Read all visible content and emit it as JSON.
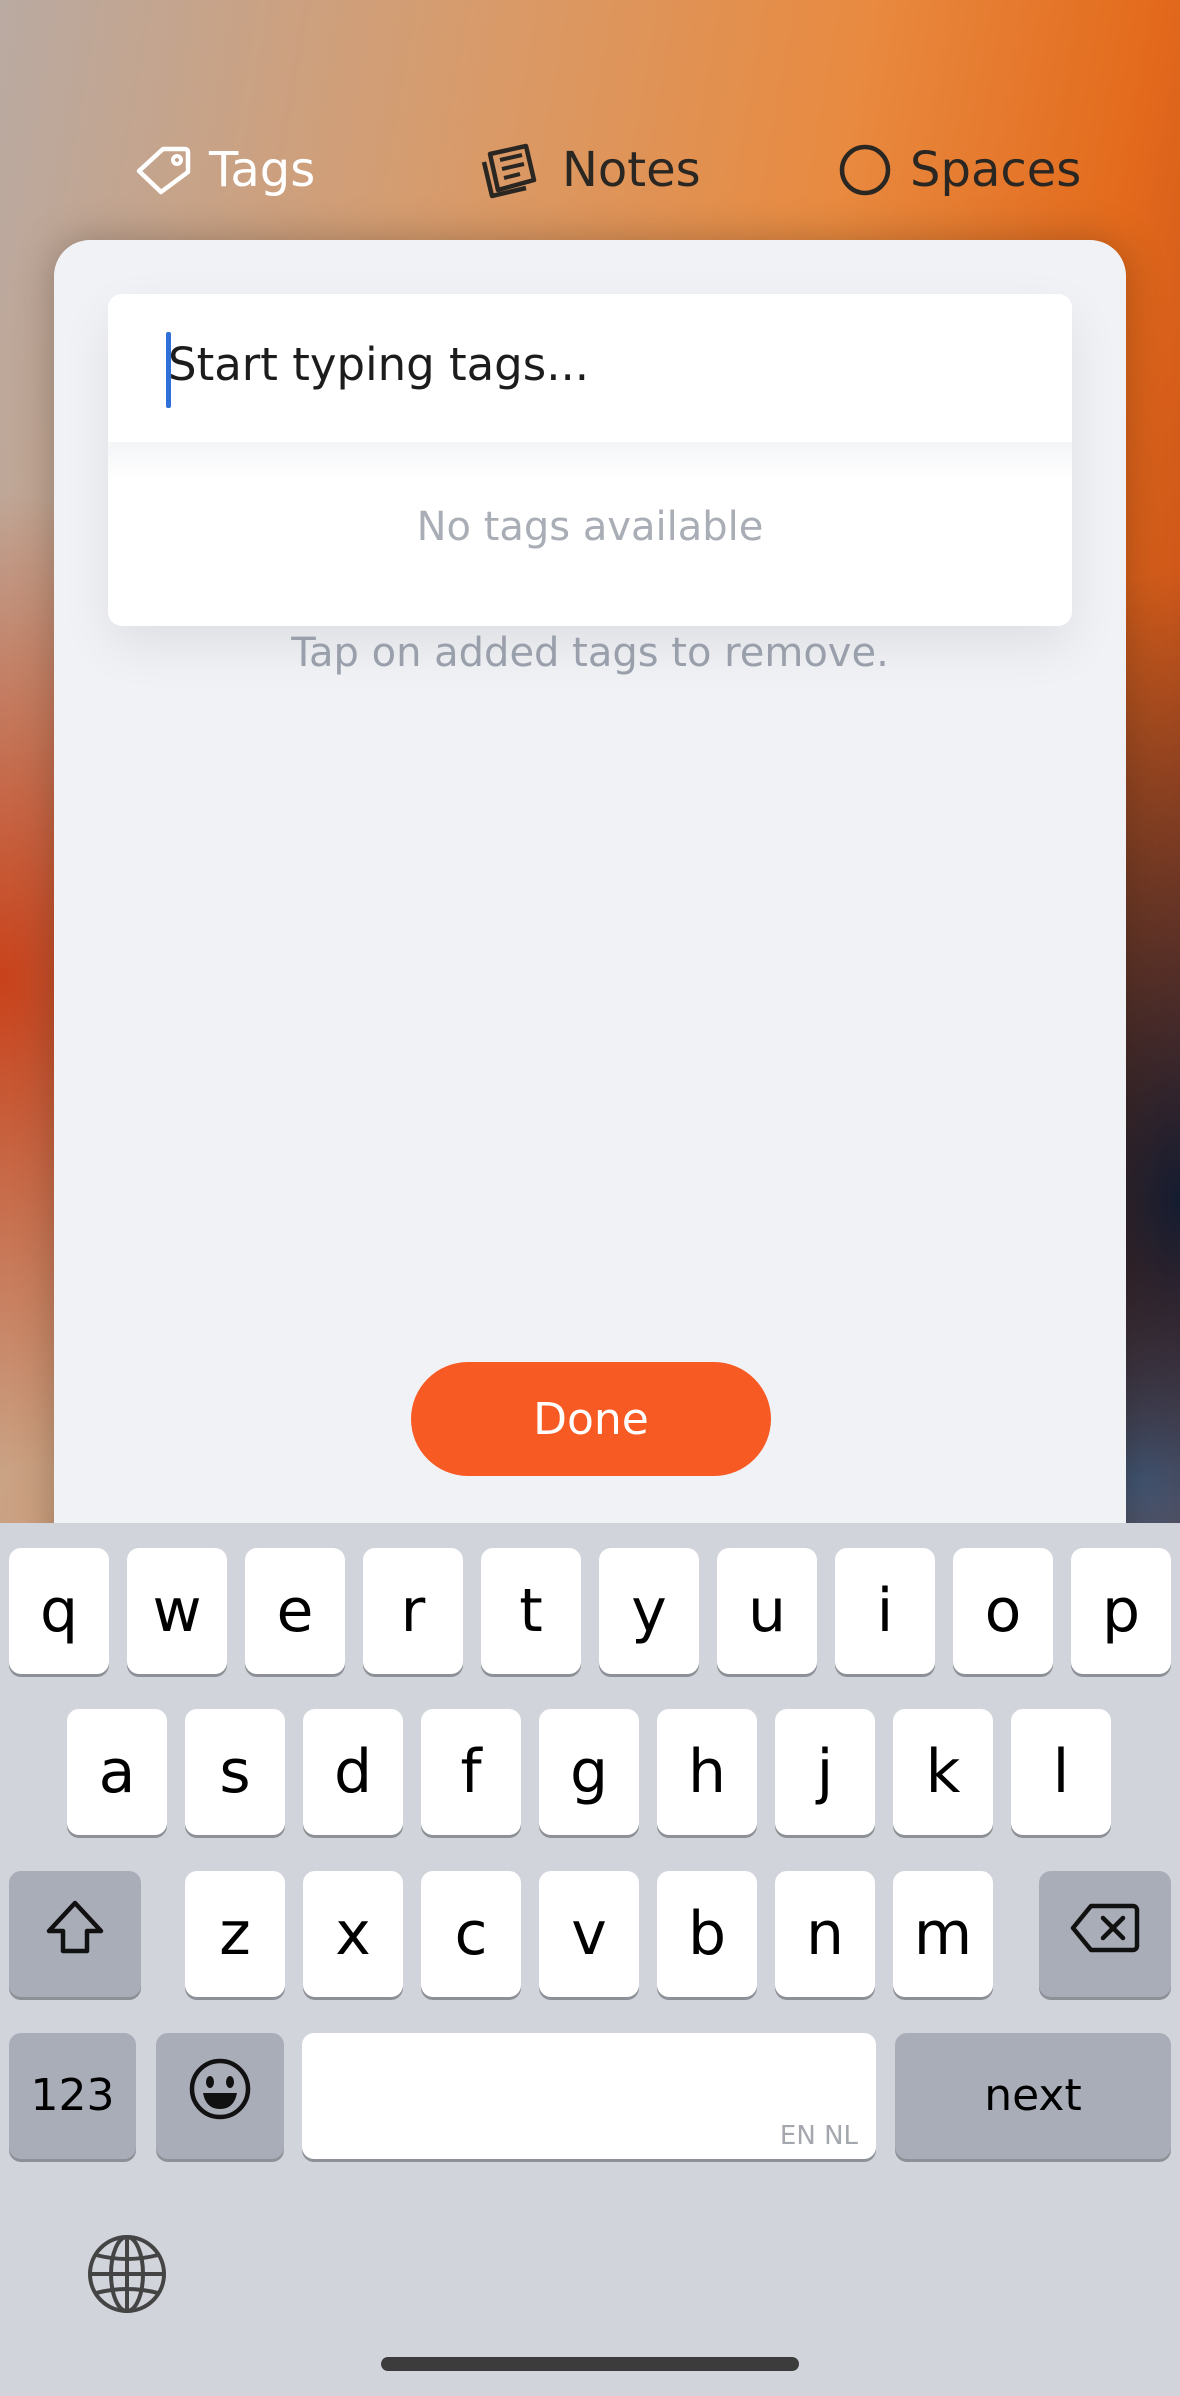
{
  "top_tabs": [
    {
      "label": "Tags",
      "icon": "tag-icon"
    },
    {
      "label": "Notes",
      "icon": "notes-icon"
    },
    {
      "label": "Spaces",
      "icon": "circle-icon"
    }
  ],
  "tag_picker": {
    "input_placeholder": "Start typing tags...",
    "empty_message": "No tags available",
    "hint": "Tap on added tags to remove.",
    "done_label": "Done"
  },
  "keyboard": {
    "row1": [
      "q",
      "w",
      "e",
      "r",
      "t",
      "y",
      "u",
      "i",
      "o",
      "p"
    ],
    "row2": [
      "a",
      "s",
      "d",
      "f",
      "g",
      "h",
      "j",
      "k",
      "l"
    ],
    "row3": [
      "z",
      "x",
      "c",
      "v",
      "b",
      "n",
      "m"
    ],
    "numbers_label": "123",
    "next_label": "next",
    "space_languages": "EN NL",
    "icons": {
      "shift": "shift-icon",
      "backspace": "backspace-icon",
      "emoji": "emoji-icon",
      "globe": "globe-icon"
    }
  },
  "colors": {
    "accent": "#f85a23",
    "cursor": "#2f6fd8",
    "sheet": "#f1f2f6",
    "keyboard": "#d2d4dc"
  }
}
